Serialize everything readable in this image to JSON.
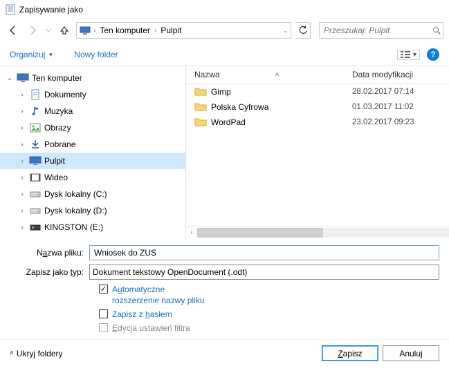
{
  "window": {
    "title": "Zapisywanie jako"
  },
  "breadcrumb": {
    "root": "Ten komputer",
    "folder": "Pulpit"
  },
  "search": {
    "placeholder": "Przeszukaj: Pulpit"
  },
  "toolbar": {
    "organize": "Organizuj",
    "newfolder": "Nowy folder"
  },
  "columns": {
    "name": "Nazwa",
    "date": "Data modyfikacji"
  },
  "tree": [
    {
      "label": "Ten komputer",
      "indent": 0,
      "expand": "down",
      "icon": "monitor"
    },
    {
      "label": "Dokumenty",
      "indent": 1,
      "expand": "right",
      "icon": "doc"
    },
    {
      "label": "Muzyka",
      "indent": 1,
      "expand": "right",
      "icon": "music"
    },
    {
      "label": "Obrazy",
      "indent": 1,
      "expand": "right",
      "icon": "pictures"
    },
    {
      "label": "Pobrane",
      "indent": 1,
      "expand": "right",
      "icon": "download"
    },
    {
      "label": "Pulpit",
      "indent": 1,
      "expand": "right",
      "icon": "monitor",
      "selected": true
    },
    {
      "label": "Wideo",
      "indent": 1,
      "expand": "right",
      "icon": "video"
    },
    {
      "label": "Dysk lokalny (C:)",
      "indent": 1,
      "expand": "right",
      "icon": "drive"
    },
    {
      "label": "Dysk lokalny (D:)",
      "indent": 1,
      "expand": "right",
      "icon": "drive"
    },
    {
      "label": "KINGSTON (E:)",
      "indent": 1,
      "expand": "right",
      "icon": "usb"
    }
  ],
  "files": [
    {
      "name": "Gimp",
      "date": "28.02.2017 07:14"
    },
    {
      "name": "Polska Cyfrowa",
      "date": "01.03.2017 11:02"
    },
    {
      "name": "WordPad",
      "date": "23.02.2017 09:23"
    }
  ],
  "form": {
    "filename_label_pre": "N",
    "filename_label_ul": "a",
    "filename_label_post": "zwa pliku:",
    "filename_value": "Wniosek do ZUS",
    "type_label_pre": "Zapisz jako ",
    "type_label_ul": "t",
    "type_label_post": "yp:",
    "type_value": "Dokument tekstowy OpenDocument (.odt)"
  },
  "options": {
    "auto_pre": "A",
    "auto_ul": "u",
    "auto_post": "tomatyczne rozszerzenie nazwy pliku",
    "auto_checked": true,
    "pwd_pre": "Zapisz z ",
    "pwd_ul": "h",
    "pwd_post": "asłem",
    "pwd_checked": false,
    "filter_pre": "",
    "filter_ul": "E",
    "filter_post": "dycja ustawień filtra",
    "filter_checked": false
  },
  "footer": {
    "hide": "Ukryj foldery",
    "save_pre": "",
    "save_ul": "Z",
    "save_post": "apisz",
    "cancel": "Anuluj"
  }
}
